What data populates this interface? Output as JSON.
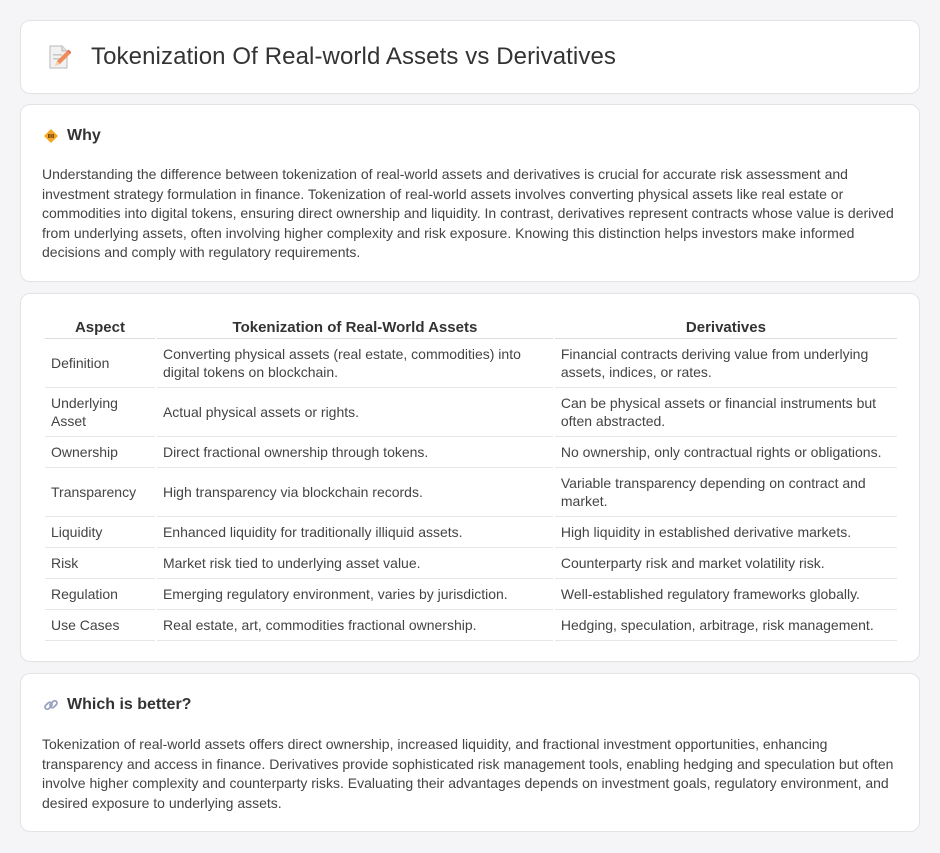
{
  "header": {
    "title": "Tokenization Of Real-world Assets vs Derivatives",
    "icon": "document-pencil-icon"
  },
  "why": {
    "title": "Why",
    "icon": "diamond-sign-icon",
    "body": "Understanding the difference between tokenization of real-world assets and derivatives is crucial for accurate risk assessment and investment strategy formulation in finance. Tokenization of real-world assets involves converting physical assets like real estate or commodities into digital tokens, ensuring direct ownership and liquidity. In contrast, derivatives represent contracts whose value is derived from underlying assets, often involving higher complexity and risk exposure. Knowing this distinction helps investors make informed decisions and comply with regulatory requirements."
  },
  "table": {
    "headers": [
      "Aspect",
      "Tokenization of Real-World Assets",
      "Derivatives"
    ],
    "rows": [
      [
        "Definition",
        "Converting physical assets (real estate, commodities) into digital tokens on blockchain.",
        "Financial contracts deriving value from underlying assets, indices, or rates."
      ],
      [
        "Underlying Asset",
        "Actual physical assets or rights.",
        "Can be physical assets or financial instruments but often abstracted."
      ],
      [
        "Ownership",
        "Direct fractional ownership through tokens.",
        "No ownership, only contractual rights or obligations."
      ],
      [
        "Transparency",
        "High transparency via blockchain records.",
        "Variable transparency depending on contract and market."
      ],
      [
        "Liquidity",
        "Enhanced liquidity for traditionally illiquid assets.",
        "High liquidity in established derivative markets."
      ],
      [
        "Risk",
        "Market risk tied to underlying asset value.",
        "Counterparty risk and market volatility risk."
      ],
      [
        "Regulation",
        "Emerging regulatory environment, varies by jurisdiction.",
        "Well-established regulatory frameworks globally."
      ],
      [
        "Use Cases",
        "Real estate, art, commodities fractional ownership.",
        "Hedging, speculation, arbitrage, risk management."
      ]
    ]
  },
  "better": {
    "title": "Which is better?",
    "icon": "link-icon",
    "body": "Tokenization of real-world assets offers direct ownership, increased liquidity, and fractional investment opportunities, enhancing transparency and access in finance. Derivatives provide sophisticated risk management tools, enabling hedging and speculation but often involve higher complexity and counterparty risks. Evaluating their advantages depends on investment goals, regulatory environment, and desired exposure to underlying assets."
  }
}
